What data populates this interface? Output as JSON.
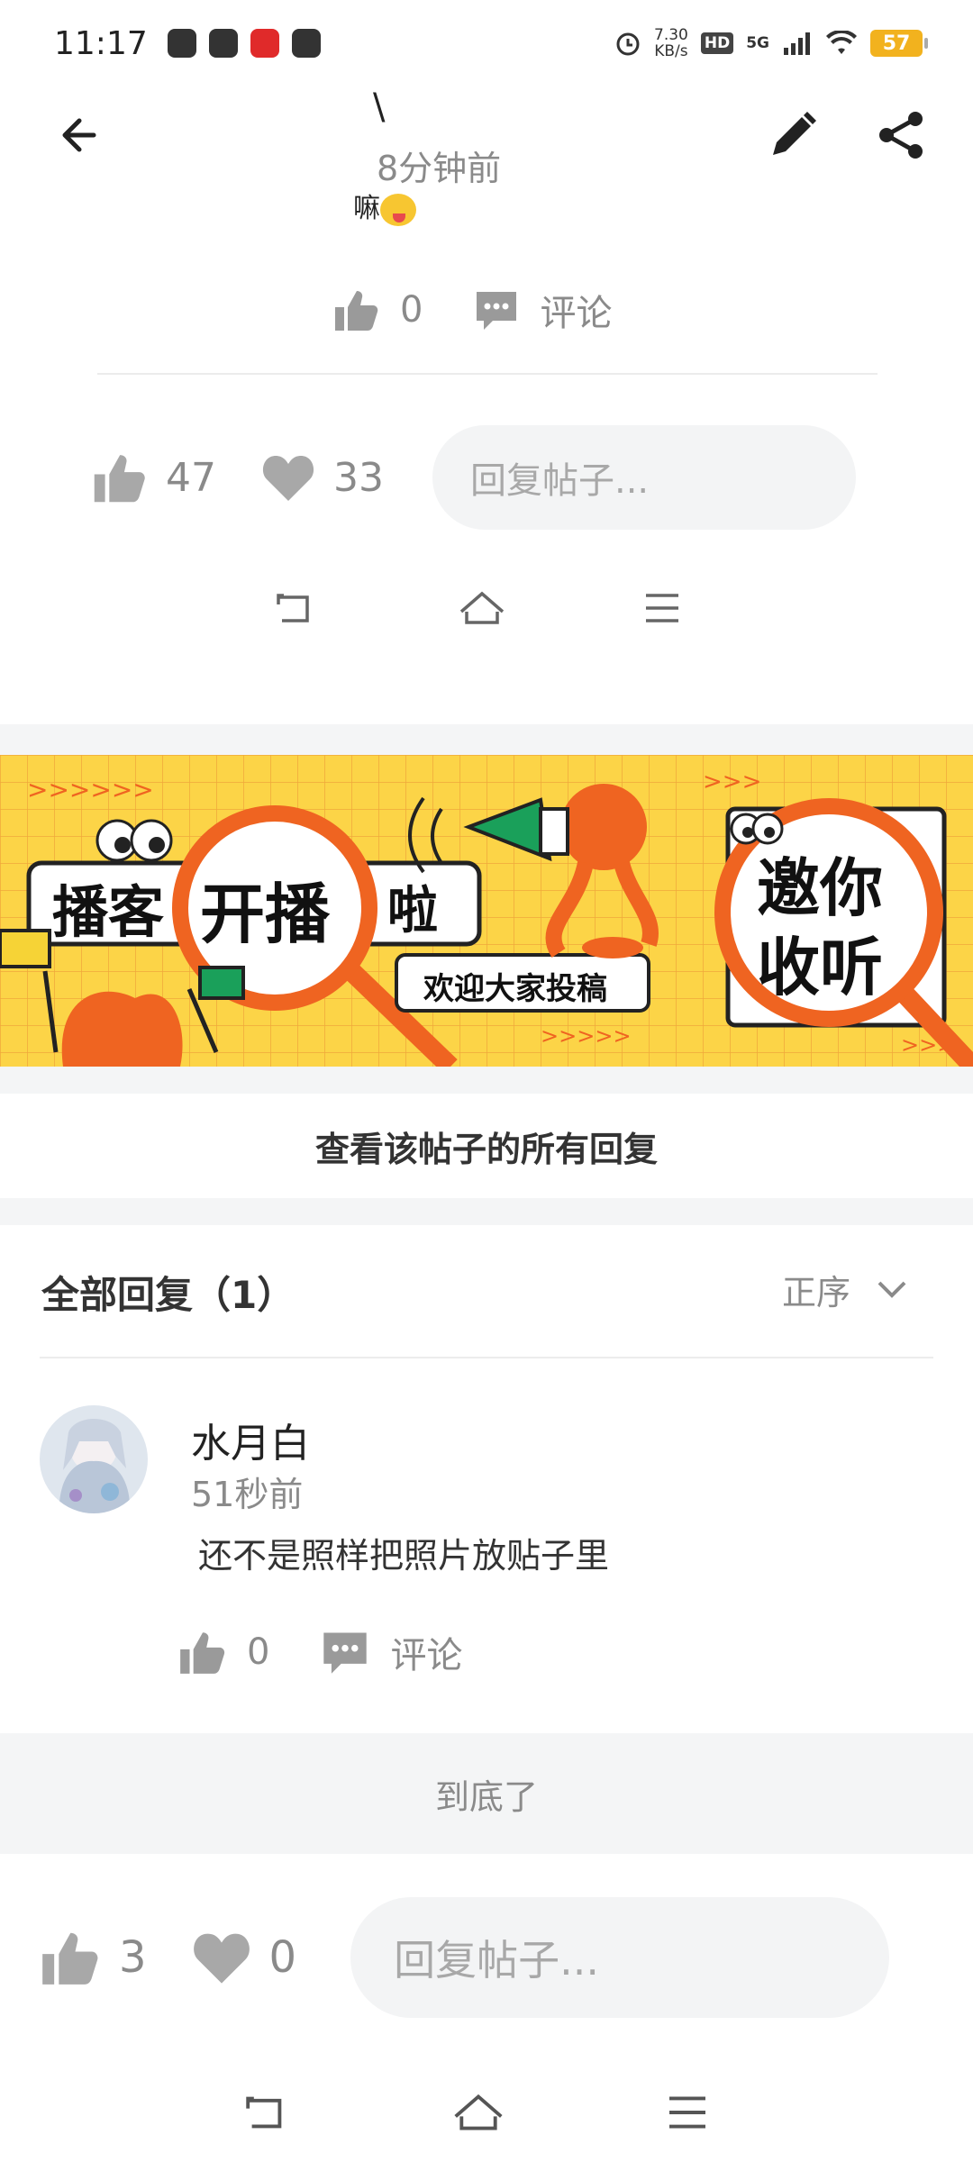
{
  "status_bar": {
    "time": "11:17",
    "net_speed_value": "7.30",
    "net_speed_unit": "KB/s",
    "hd": "HD",
    "network": "5G",
    "battery": "57"
  },
  "header": {
    "author_name": "\\",
    "post_time": "8分钟前"
  },
  "post": {
    "text": "嘛",
    "like_count": "0",
    "comment_label": "评论"
  },
  "inner_bar": {
    "likes": "47",
    "favorites": "33",
    "reply_placeholder": "回复帖子..."
  },
  "banner": {
    "text_left_1": "播客",
    "text_highlight": "开播",
    "text_left_2": "啦",
    "text_sub": "欢迎大家投稿",
    "text_right_1": "邀你",
    "text_right_2": "收听",
    "colors": {
      "background": "#fcd447",
      "accent": "#ef6421",
      "green": "#1aa05a"
    }
  },
  "view_all": "查看该帖子的所有回复",
  "replies": {
    "title": "全部回复（1）",
    "sort_label": "正序",
    "items": [
      {
        "name": "水月白",
        "time": "51秒前",
        "text": "还不是照样把照片放贴子里",
        "like_count": "0",
        "comment_label": "评论"
      }
    ]
  },
  "end_label": "到底了",
  "bottom_bar": {
    "likes": "3",
    "favorites": "0",
    "reply_placeholder": "回复帖子..."
  }
}
